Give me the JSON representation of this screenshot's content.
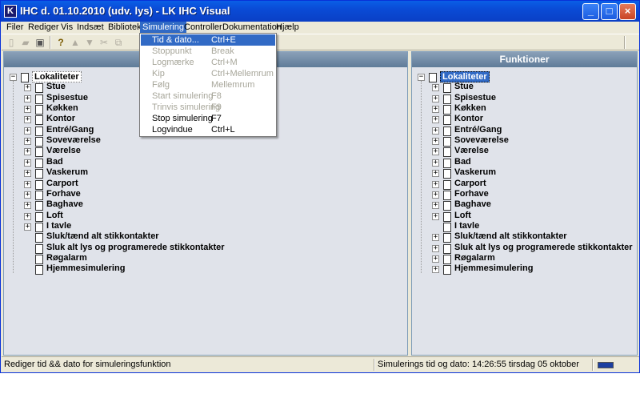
{
  "window": {
    "title": "IHC d. 01.10.2010 (udv. lys) - LK IHC Visual",
    "app_icon_letter": "K"
  },
  "menubar": {
    "items": [
      "Filer",
      "Rediger",
      "Vis",
      "Indsæt",
      "Bibliotek",
      "Simulering",
      "Controller",
      "Dokumentation",
      "Hjælp"
    ],
    "active": "Simulering"
  },
  "toolbar": {
    "icons": [
      "new-document-icon",
      "open-folder-icon",
      "save-icon",
      "help-icon",
      "upload-icon",
      "download-icon",
      "cut-icon",
      "copy-icon"
    ]
  },
  "simulation_menu": [
    {
      "label": "Tid & dato...",
      "shortcut": "Ctrl+E",
      "state": "highlighted"
    },
    {
      "label": "Stoppunkt",
      "shortcut": "Break",
      "state": "disabled"
    },
    {
      "label": "Logmærke",
      "shortcut": "Ctrl+M",
      "state": "disabled"
    },
    {
      "label": "Kip",
      "shortcut": "Ctrl+Mellemrum",
      "state": "disabled"
    },
    {
      "label": "Følg",
      "shortcut": "Mellemrum",
      "state": "disabled"
    },
    {
      "label": "Start simulering",
      "shortcut": "F8",
      "state": "disabled"
    },
    {
      "label": "Trinvis simulering",
      "shortcut": "F9",
      "state": "disabled"
    },
    {
      "label": "Stop simulering",
      "shortcut": "F7",
      "state": "enabled"
    },
    {
      "label": "Logvindue",
      "shortcut": "Ctrl+L",
      "state": "enabled"
    }
  ],
  "left_pane": {
    "header": "",
    "root": "Lokaliteter",
    "items": [
      {
        "label": "Stue",
        "expandable": true
      },
      {
        "label": "Spisestue",
        "expandable": true
      },
      {
        "label": "Køkken",
        "expandable": true
      },
      {
        "label": "Kontor",
        "expandable": true
      },
      {
        "label": "Entré/Gang",
        "expandable": true
      },
      {
        "label": "Soveværelse",
        "expandable": true
      },
      {
        "label": "Værelse",
        "expandable": true
      },
      {
        "label": "Bad",
        "expandable": true
      },
      {
        "label": "Vaskerum",
        "expandable": true
      },
      {
        "label": "Carport",
        "expandable": true
      },
      {
        "label": "Forhave",
        "expandable": true
      },
      {
        "label": "Baghave",
        "expandable": true
      },
      {
        "label": "Loft",
        "expandable": true
      },
      {
        "label": "I tavle",
        "expandable": true
      },
      {
        "label": "Sluk/tænd alt stikkontakter",
        "expandable": false
      },
      {
        "label": "Sluk alt lys og programerede stikkontakter",
        "expandable": false
      },
      {
        "label": "Røgalarm",
        "expandable": false
      },
      {
        "label": "Hjemmesimulering",
        "expandable": false
      }
    ]
  },
  "right_pane": {
    "header": "Funktioner",
    "root": "Lokaliteter",
    "items": [
      {
        "label": "Stue",
        "expandable": true
      },
      {
        "label": "Spisestue",
        "expandable": true
      },
      {
        "label": "Køkken",
        "expandable": true
      },
      {
        "label": "Kontor",
        "expandable": true
      },
      {
        "label": "Entré/Gang",
        "expandable": true
      },
      {
        "label": "Soveværelse",
        "expandable": true
      },
      {
        "label": "Værelse",
        "expandable": true
      },
      {
        "label": "Bad",
        "expandable": true
      },
      {
        "label": "Vaskerum",
        "expandable": true
      },
      {
        "label": "Carport",
        "expandable": true
      },
      {
        "label": "Forhave",
        "expandable": true
      },
      {
        "label": "Baghave",
        "expandable": true
      },
      {
        "label": "Loft",
        "expandable": true
      },
      {
        "label": "I tavle",
        "expandable": false
      },
      {
        "label": "Sluk/tænd alt stikkontakter",
        "expandable": true
      },
      {
        "label": "Sluk alt lys og programerede stikkontakter",
        "expandable": true
      },
      {
        "label": "Røgalarm",
        "expandable": true
      },
      {
        "label": "Hjemmesimulering",
        "expandable": true
      }
    ]
  },
  "statusbar": {
    "hint": "Rediger tid && dato for simuleringsfunktion",
    "sim_time": "Simulerings tid og dato: 14:26:55 tirsdag  05 oktober"
  },
  "colors": {
    "title_bar": "#0a4bd6",
    "highlight": "#316ac5",
    "pane_bg": "#e0e3ea",
    "pane_header": "#6f89a6"
  }
}
